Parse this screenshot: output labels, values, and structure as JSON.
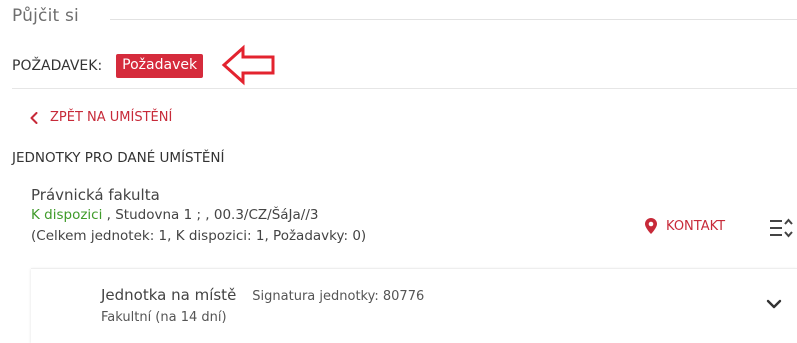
{
  "section": {
    "title": "Půjčit si"
  },
  "request": {
    "label": "POŽADAVEK:",
    "button_label": "Požadavek"
  },
  "navigation": {
    "back_label": "ZPĚT NA UMÍSTĚNÍ"
  },
  "units": {
    "heading": "JEDNOTKY PRO DANÉ UMÍSTĚNÍ"
  },
  "location": {
    "name": "Právnická fakulta",
    "availability": "K dispozici",
    "location_detail": " , Studovna 1 ; , 00.3/CZ/ŠáJa//3",
    "summary": "(Celkem jednotek: 1, K dispozici: 1, Požadavky: 0)",
    "contact_label": "KONTAKT"
  },
  "unit_item": {
    "title": "Jednotka na místě",
    "signature": "Signatura jednotky: 80776",
    "loan_type": "Fakultní (na 14 dní)"
  },
  "colors": {
    "accent_red": "#d52b3c",
    "link_red": "#c72a39",
    "available_green": "#3f9b2a"
  },
  "icons": {
    "back": "chevron-left-icon",
    "contact": "map-marker-icon",
    "sort": "sort-list-icon",
    "expand": "chevron-down-icon",
    "annotation": "arrow-left-outline-icon"
  }
}
